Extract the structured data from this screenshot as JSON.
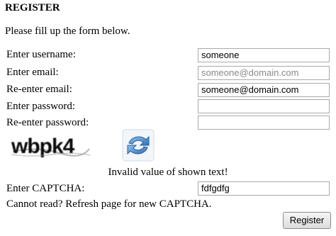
{
  "page": {
    "title": "REGISTER",
    "intro": "Please fill up the form below."
  },
  "form": {
    "username": {
      "label": "Enter username:",
      "value": "someone"
    },
    "email": {
      "label": "Enter email:",
      "placeholder": "someone@domain.com"
    },
    "reemail": {
      "label": "Re-enter email:",
      "value": "someone@domain.com"
    },
    "password": {
      "label": "Enter password:",
      "value": ""
    },
    "repassword": {
      "label": "Re-enter password:",
      "value": ""
    },
    "captcha_image_text": "wbpk4",
    "refresh_icon": "refresh-icon",
    "error": "Invalid value of shown text!",
    "captcha": {
      "label": "Enter CAPTCHA:",
      "value": "fdfgdfg"
    },
    "hint": "Cannot read? Refresh page for new CAPTCHA.",
    "register_label": "Register"
  },
  "colors": {
    "field_border": "#a9a9a9",
    "placeholder_text": "#8a8a8a",
    "refresh_blue": "#3a7fc4"
  }
}
